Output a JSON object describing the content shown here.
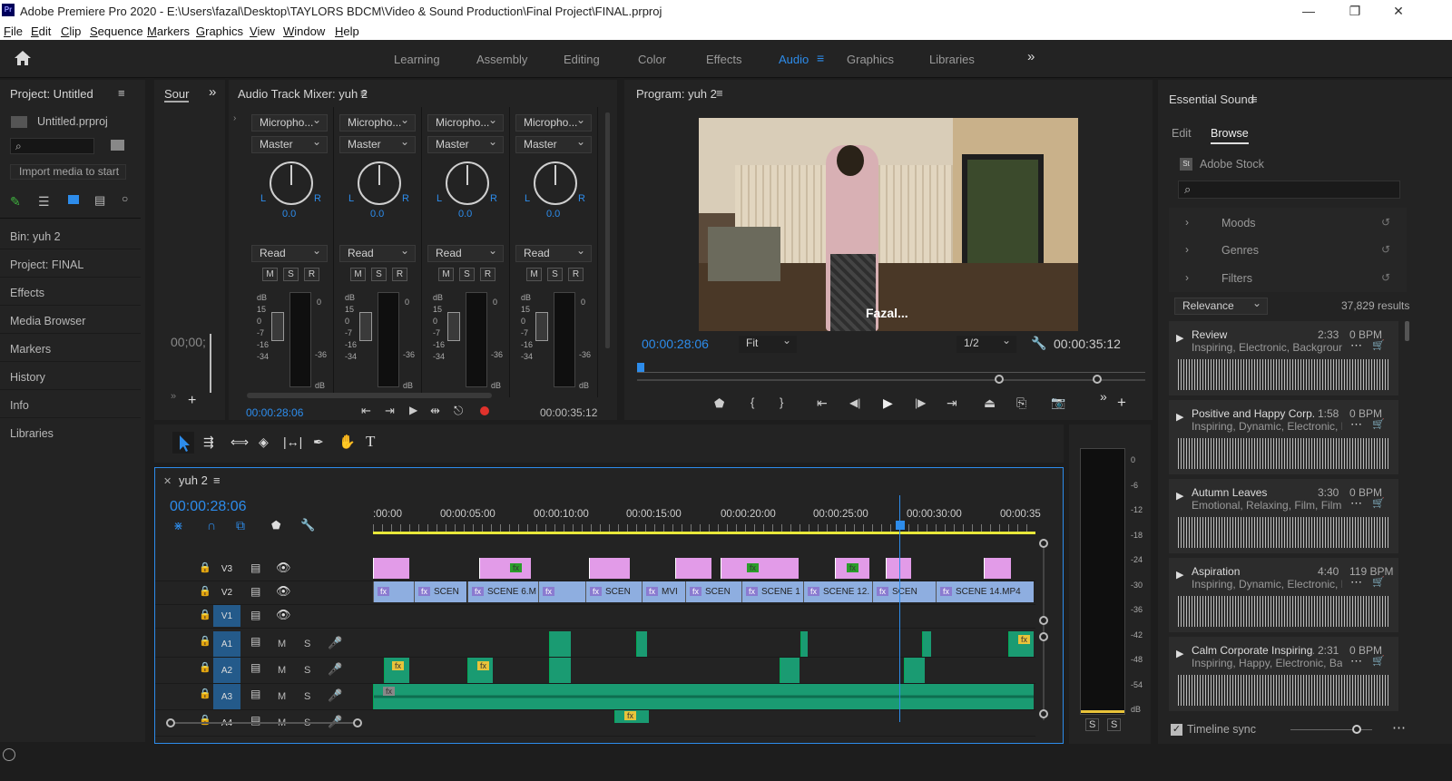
{
  "window": {
    "title": "Adobe Premiere Pro 2020 - E:\\Users\\fazal\\Desktop\\TAYLORS BDCM\\Video & Sound Production\\Final Project\\FINAL.prproj",
    "logo": "Pr"
  },
  "menu": [
    "File",
    "Edit",
    "Clip",
    "Sequence",
    "Markers",
    "Graphics",
    "View",
    "Window",
    "Help"
  ],
  "workspaces": {
    "items": [
      "Learning",
      "Assembly",
      "Editing",
      "Color",
      "Effects",
      "Audio",
      "Graphics",
      "Libraries"
    ],
    "active": "Audio"
  },
  "project_panel": {
    "title": "Project: Untitled",
    "file": "Untitled.prproj",
    "import_hint": "Import media to start",
    "items": [
      "Bin: yuh 2",
      "Project: FINAL",
      "Effects",
      "Media Browser",
      "Markers",
      "History",
      "Info",
      "Libraries"
    ]
  },
  "source_panel": {
    "tab": "Sour",
    "timecode": "00;00;"
  },
  "mixer": {
    "title": "Audio Track Mixer: yuh 2",
    "channels": [
      {
        "input": "Micropho...",
        "output": "Master",
        "value": "0.0",
        "mode": "Read"
      },
      {
        "input": "Micropho...",
        "output": "Master",
        "value": "0.0",
        "mode": "Read"
      },
      {
        "input": "Micropho...",
        "output": "Master",
        "value": "0.0",
        "mode": "Read"
      },
      {
        "input": "Micropho...",
        "output": "Master",
        "value": "0.0",
        "mode": "Read"
      }
    ],
    "buttons": [
      "M",
      "S",
      "R"
    ],
    "scale_left": [
      "dB",
      "15",
      "0",
      "-7",
      "-16",
      "-34"
    ],
    "scale_right": [
      "0",
      "-36",
      "dB"
    ],
    "pan_l": "L",
    "pan_r": "R",
    "timecode_in": "00:00:28:06",
    "timecode_out": "00:00:35:12"
  },
  "program": {
    "title": "Program: yuh 2",
    "subtitle": "Fazal...",
    "timecode": "00:00:28:06",
    "fit": "Fit",
    "resolution": "1/2",
    "duration": "00:00:35:12"
  },
  "timeline": {
    "tab": "yuh 2",
    "timecode": "00:00:28:06",
    "ruler": [
      ":00:00",
      "00:00:05:00",
      "00:00:10:00",
      "00:00:15:00",
      "00:00:20:00",
      "00:00:25:00",
      "00:00:30:00",
      "00:00:35"
    ],
    "video_tracks": [
      "V3",
      "V2",
      "V1"
    ],
    "audio_tracks": [
      "A1",
      "A2",
      "A3",
      "A4"
    ],
    "track_buttons": {
      "mute": "M",
      "solo": "S"
    },
    "fx_badge": "fx",
    "v2_clips": [
      "",
      "SCEN",
      "SCENE 6.M",
      "",
      "SCEN",
      "MVI",
      "SCEN",
      "SCENE 1",
      "SCENE 12.",
      "SCEN",
      "SCENE 14.MP4"
    ]
  },
  "master_meter": {
    "scale": [
      "0",
      "-6",
      "-12",
      "-18",
      "-24",
      "-30",
      "-36",
      "-42",
      "-48",
      "-54",
      "dB"
    ],
    "buttons": [
      "S",
      "S"
    ]
  },
  "essential_sound": {
    "title": "Essential Sound",
    "tabs": [
      "Edit",
      "Browse"
    ],
    "active_tab": "Browse",
    "source": "Adobe Stock",
    "source_badge": "St",
    "filters": [
      "Moods",
      "Genres",
      "Filters"
    ],
    "sort": "Relevance",
    "results": "37,829 results",
    "tracks": [
      {
        "title": "Review",
        "duration": "2:33",
        "bpm": "0 BPM",
        "tags": "Inspiring, Electronic, Background"
      },
      {
        "title": "Positive and Happy Corp...",
        "duration": "1:58",
        "bpm": "0 BPM",
        "tags": "Inspiring, Dynamic, Electronic, B..."
      },
      {
        "title": "Autumn Leaves",
        "duration": "3:30",
        "bpm": "0 BPM",
        "tags": "Emotional, Relaxing, Film, Film"
      },
      {
        "title": "Aspiration",
        "duration": "4:40",
        "bpm": "119 BPM",
        "tags": "Inspiring, Dynamic, Electronic, B..."
      },
      {
        "title": "Calm Corporate Inspiring...",
        "duration": "2:31",
        "bpm": "0 BPM",
        "tags": "Inspiring, Happy, Electronic, Bac..."
      }
    ],
    "timeline_sync": "Timeline sync"
  },
  "colors": {
    "accent": "#2d8ceb",
    "pink_clip": "#e29be8",
    "blue_clip": "#8eaee0",
    "audio_clip": "#1a9b72",
    "work_area": "#e8e83a",
    "record": "#e0322c"
  }
}
